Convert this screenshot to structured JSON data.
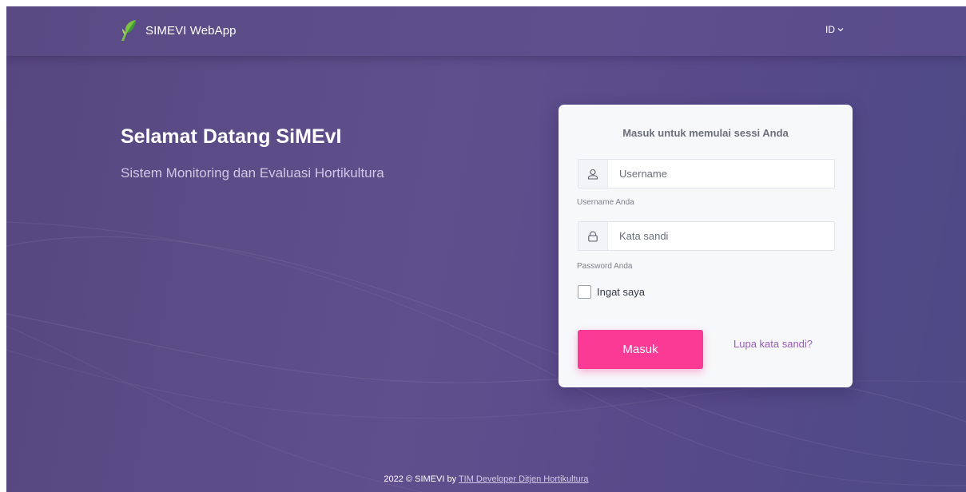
{
  "navbar": {
    "brand_name": "SIMEVI WebApp",
    "language": "ID"
  },
  "hero": {
    "title": "Selamat Datang SiMEvI",
    "subtitle": "Sistem Monitoring dan Evaluasi Hortikultura"
  },
  "login": {
    "heading": "Masuk untuk memulai sessi Anda",
    "username": {
      "value": "",
      "placeholder": "Username",
      "help": "Username Anda"
    },
    "password": {
      "value": "",
      "placeholder": "Kata sandi",
      "help": "Password Anda"
    },
    "remember_label": "Ingat saya",
    "remember_checked": false,
    "submit_label": "Masuk",
    "forgot_label": "Lupa kata sandi?"
  },
  "footer": {
    "prefix": "2022 © SIMEVI by",
    "link_text": "TIM Developer Ditjen Hortikultura"
  },
  "colors": {
    "primary_button": "#fa3a94",
    "link": "#9a5ab8",
    "background": "#5f4f8c"
  },
  "icons": {
    "brand": "leaf-logo-icon",
    "language": "chevron-down-icon",
    "username": "user-icon",
    "password": "lock-icon"
  }
}
